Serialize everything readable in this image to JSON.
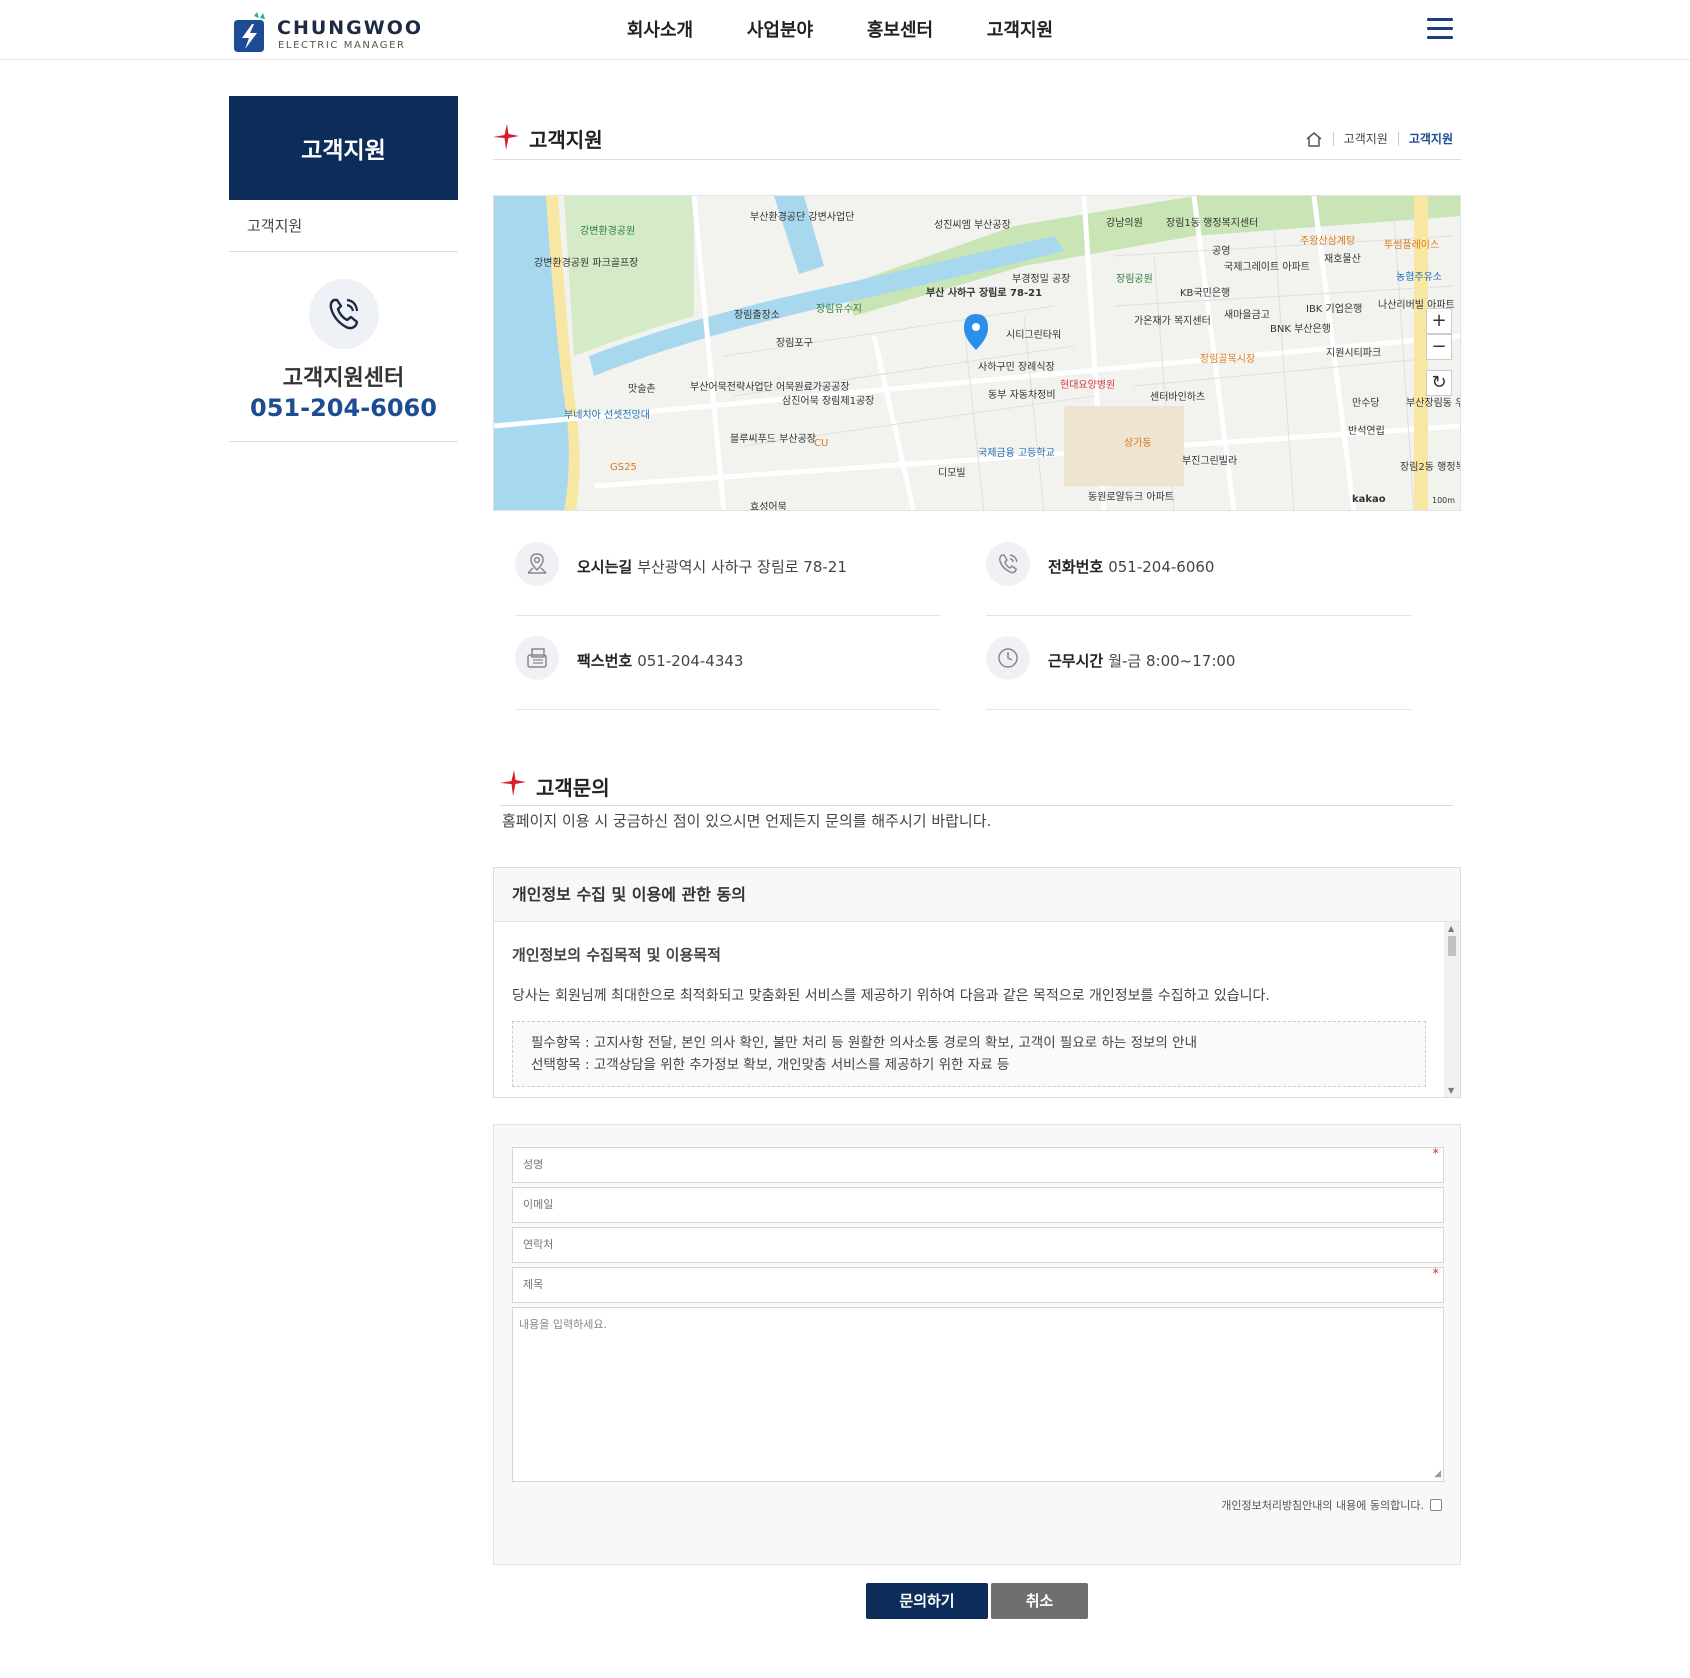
{
  "header": {
    "logo_text": "CHUNGWOO",
    "logo_sub": "ELECTRIC MANAGER",
    "nav": [
      "회사소개",
      "사업분야",
      "홍보센터",
      "고객지원"
    ]
  },
  "sidebar": {
    "title": "고객지원",
    "menu_item": "고객지원",
    "cs_title": "고객지원센터",
    "cs_phone": "051-204-6060"
  },
  "page": {
    "title": "고객지원",
    "breadcrumb": [
      "고객지원",
      "고객지원"
    ]
  },
  "map": {
    "labels": [
      "강변환경공원",
      "부산환경공단 강변사업단",
      "성진씨엠 부산공장",
      "강남의원",
      "장림1동 행정복지센터",
      "주왕산삼계탕",
      "투썸플레이스",
      "강변환경공원 파크골프장",
      "공영",
      "국제그레이트 아파트",
      "재호물산",
      "농협주유소",
      "부산 사하구 장림로 78-21",
      "장림공원",
      "KB국민은행",
      "장림출장소",
      "장림유수지",
      "부경정밀 공장",
      "새마을금고",
      "IBK 기업은행",
      "나산리버빌 아파트",
      "시티그린타워",
      "가온재가 복지센터",
      "BNK 부산은행",
      "지원시티파크",
      "장림포구",
      "장림골목시장",
      "사하구민 장례식장",
      "현대요양병원",
      "맛술촌",
      "부산어묵전략사업단 어묵원료가공공장",
      "삼진어묵 장림제1공장",
      "동부 자동차정비",
      "센터바인하츠",
      "만수당",
      "부산장림동 우체국",
      "부네치아 선셋전망대",
      "블루씨푸드 부산공장",
      "CU",
      "상가동",
      "반석연립",
      "GS25",
      "국제금융 고등학교",
      "디모빌",
      "부진그린빌라",
      "장림2동 행정복지센터",
      "효성어묵",
      "동원로얄듀크 아파트",
      "kakao",
      "100m"
    ]
  },
  "info": {
    "address_label": "오시는길",
    "address": "부산광역시 사하구 장림로 78-21",
    "phone_label": "전화번호",
    "phone": "051-204-6060",
    "fax_label": "팩스번호",
    "fax": "051-204-4343",
    "hours_label": "근무시간",
    "hours": "월-금 8:00~17:00"
  },
  "inquiry": {
    "title": "고객문의",
    "desc": "홈페이지 이용 시 궁금하신 점이 있으시면 언제든지 문의를 해주시기 바랍니다.",
    "agree_title": "개인정보 수집 및 이용에 관한 동의",
    "agree_sub": "개인정보의 수집목적 및 이용목적",
    "agree_p": "당사는 회원님께 최대한으로 최적화되고 맞춤화된 서비스를 제공하기 위하여 다음과 같은 목적으로 개인정보를 수집하고 있습니다.",
    "required": "필수항목 : 고지사항 전달, 본인 의사 확인, 불만 처리 등 원활한 의사소통 경로의 확보, 고객이 필요로 하는 정보의 안내",
    "optional": "선택항목 : 고객상담을 위한 추가정보 확보, 개인맞춤 서비스를 제공하기 위한 자료 등"
  },
  "form": {
    "name_ph": "성명",
    "email_ph": "이메일",
    "contact_ph": "연락처",
    "subject_ph": "제목",
    "content_ph": "내용을 입력하세요.",
    "consent": "개인정보처리방침안내의 내용에 동의합니다.",
    "submit": "문의하기",
    "cancel": "취소"
  },
  "colors": {
    "navy": "#0c2d5a",
    "accent_blue": "#1e4c94",
    "star_red": "#d81e2b",
    "cancel_gray": "#6f6f6f"
  }
}
